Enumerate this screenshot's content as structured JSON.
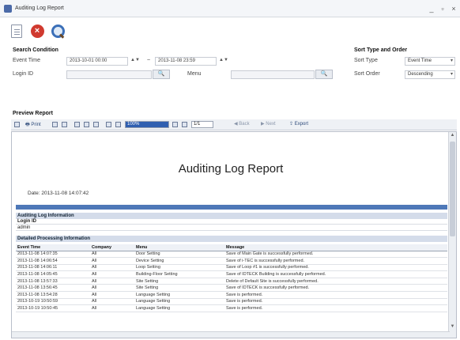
{
  "window": {
    "title": "Auditing Log Report",
    "controls": [
      "_",
      "▫",
      "×"
    ]
  },
  "toolbar": {
    "icons": [
      "new-document-icon",
      "close-icon",
      "search-icon"
    ]
  },
  "search": {
    "title": "Search Condition",
    "event_time_label": "Event Time",
    "start_time": "2013-10-01 00:00",
    "end_time": "2013-11-08 23:59",
    "spin": "▲▼",
    "range_sep": "~",
    "login_id_label": "Login ID",
    "login_id_value": "",
    "menu_label": "Menu",
    "menu_value": "",
    "pick_button": "🔍"
  },
  "sort": {
    "title": "Sort Type and Order",
    "type_label": "Sort Type",
    "type_value": "Event Time",
    "order_label": "Sort Order",
    "order_value": "Descending"
  },
  "preview": {
    "title": "Preview Report",
    "print_label": "Print",
    "zoom_value": "100%",
    "page_value": "1/1",
    "back_label": "Back",
    "next_label": "Next",
    "export_label": "Export"
  },
  "report": {
    "title": "Auditing Log Report",
    "date": "Date: 2013-11-08 14:07:42",
    "info_header": "Auditing Log Information",
    "login_id_header": "Login ID",
    "login_id_value": "admin",
    "detail_header": "Detailed Processing Information",
    "columns": [
      "Event Time",
      "Company",
      "Menu",
      "Message"
    ],
    "rows": [
      [
        "2013-11-08 14:07:35",
        "All",
        "Door Setting",
        "Save of Main Gate is successfully performed."
      ],
      [
        "2013-11-08 14:06:54",
        "All",
        "Device Setting",
        "Save of i-TEC is successfully performed."
      ],
      [
        "2013-11-08 14:06:11",
        "All",
        "Loop Setting",
        "Save of Loop #1 is successfully performed."
      ],
      [
        "2013-11-08 14:05:45",
        "All",
        "Building-Floor Setting",
        "Save of IDTECK Building is successfully performed."
      ],
      [
        "2013-11-08 13:57:33",
        "All",
        "Site Setting",
        "Delete of Default Site is successfully performed."
      ],
      [
        "2013-11-08 13:56:45",
        "All",
        "Site Setting",
        "Save of IDTECK is successfully performed."
      ],
      [
        "2013-11-08 13:54:28",
        "All",
        "Language Setting",
        "Save is performed."
      ],
      [
        "2013-10-19 10:50:59",
        "All",
        "Language Setting",
        "Save is performed."
      ],
      [
        "2013-10-19 10:50:45",
        "All",
        "Language Setting",
        "Save is performed."
      ]
    ]
  }
}
